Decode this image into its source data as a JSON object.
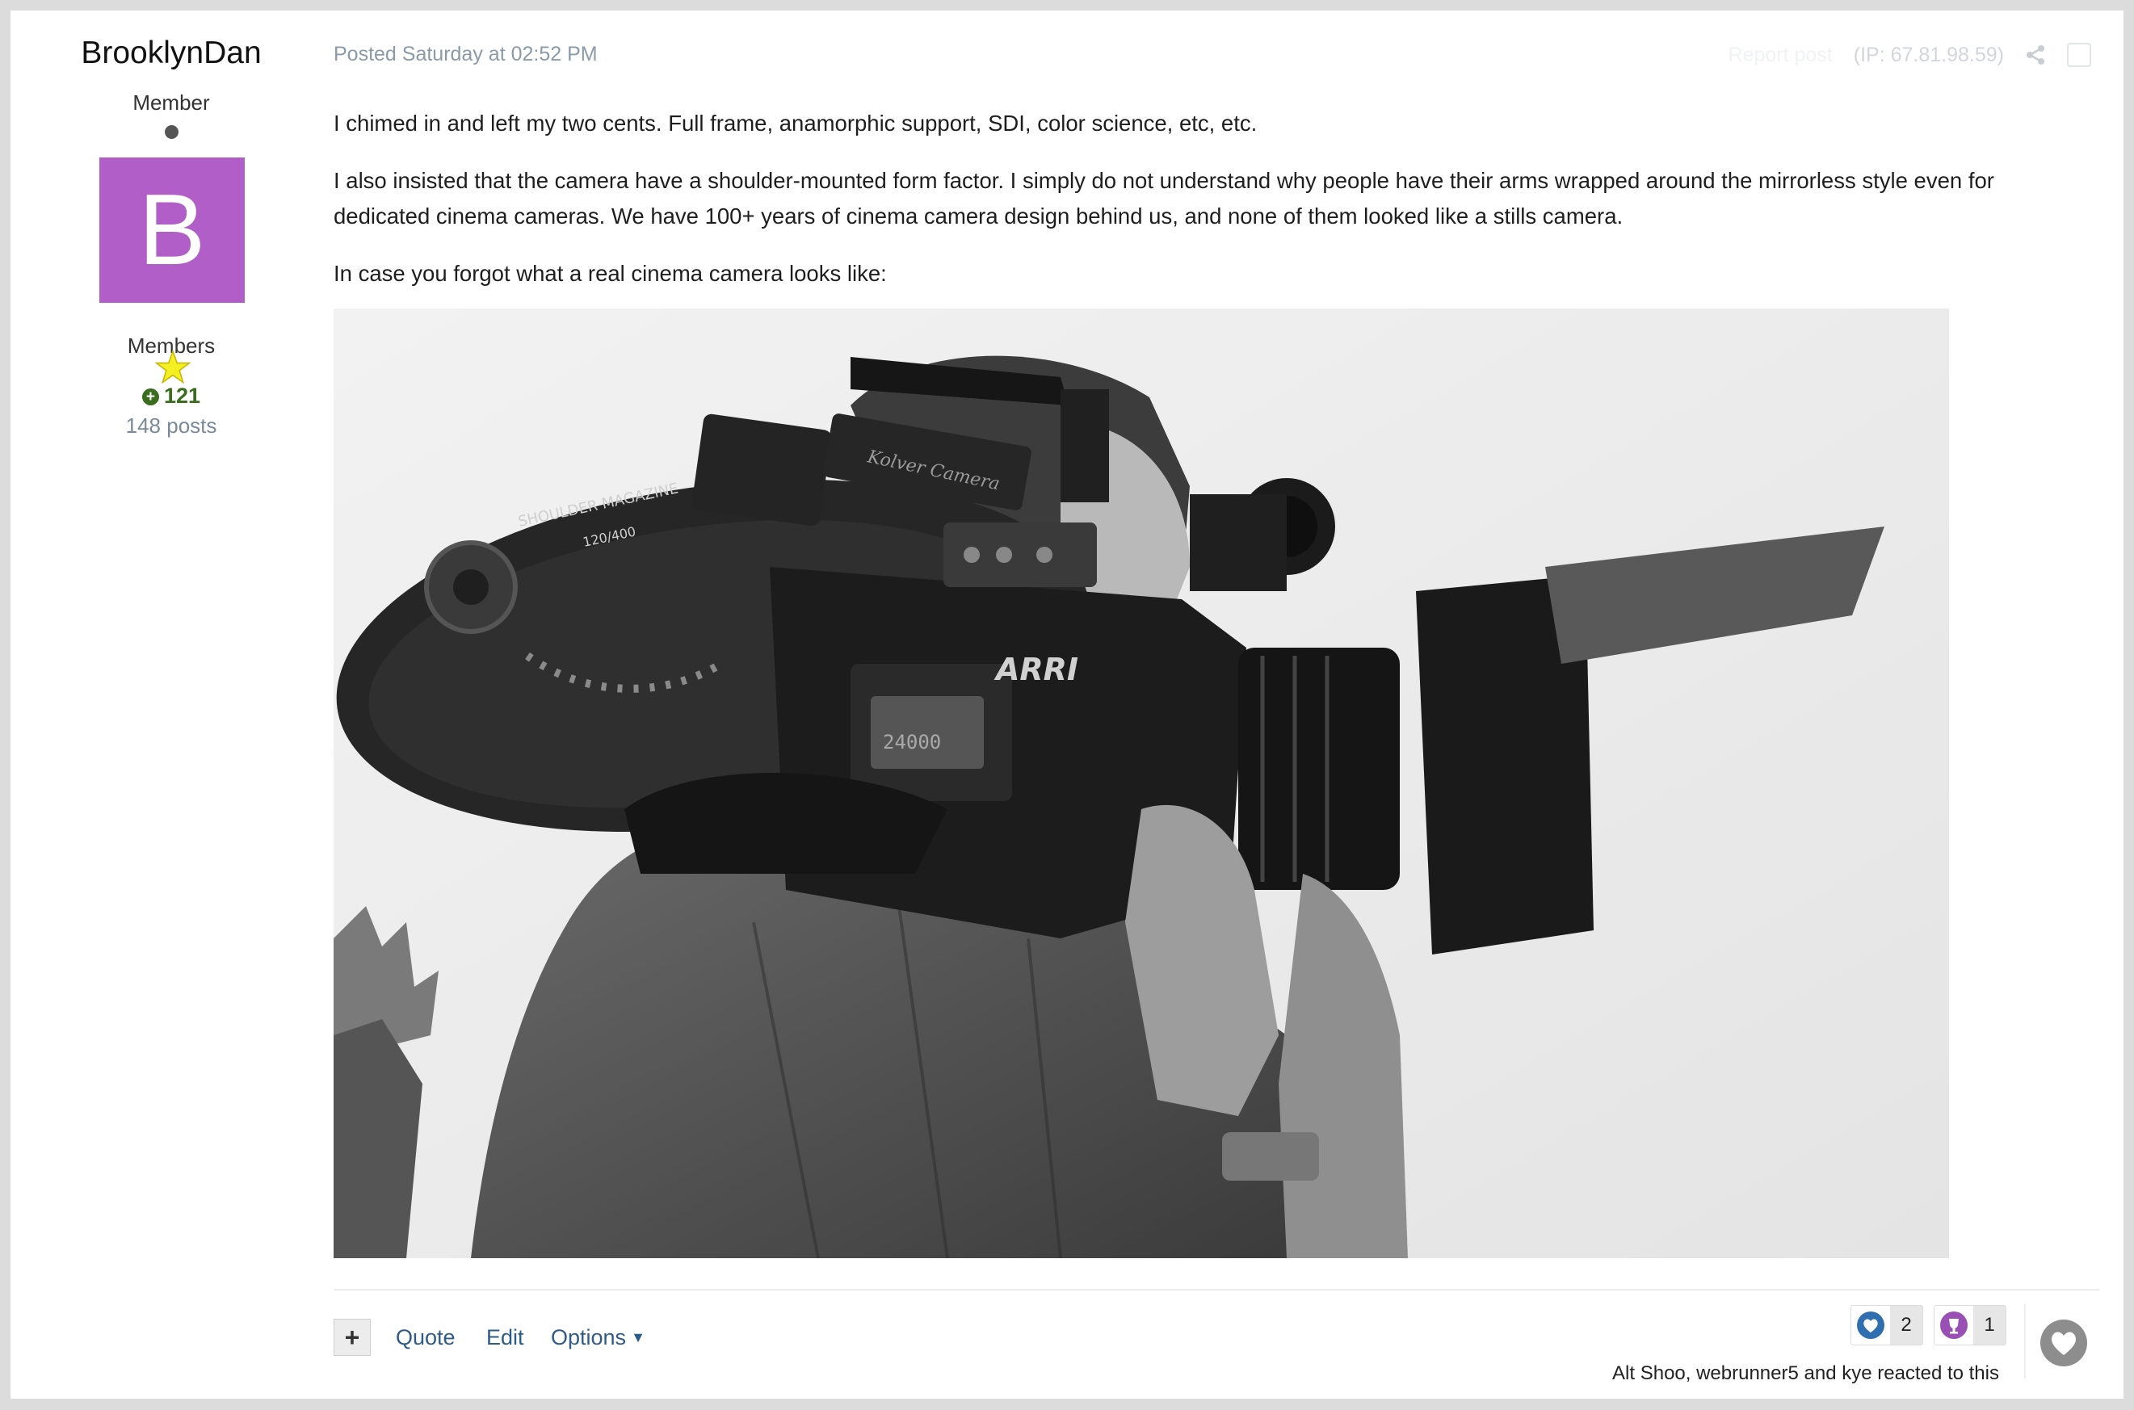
{
  "author": {
    "name": "BrooklynDan",
    "title": "Member",
    "avatar_letter": "B",
    "avatar_color": "#b25ec8",
    "group": "Members",
    "reputation": "121",
    "posts": "148 posts"
  },
  "post": {
    "meta": "Posted Saturday at 02:52 PM",
    "report_label": "Report post",
    "ip_label": "(IP: 67.81.98.59)",
    "paragraphs": [
      "I chimed in and left my two cents. Full frame, anamorphic support, SDI, color science, etc, etc.",
      "I also insisted that the camera have a shoulder-mounted form factor. I simply do not understand why people have their arms wrapped around the mirrorless style even for dedicated cinema cameras. We have 100+ years of cinema camera design behind us, and none of them looked like a stills camera.",
      "In case you forgot what a real cinema camera looks like:"
    ],
    "image_labels": {
      "magazine": "SHOULDER MAGAZINE",
      "magazine_size": "120/400",
      "brand": "ARRI",
      "model_text": "Kolver Camera",
      "display": "24000"
    }
  },
  "actions": {
    "plus": "+",
    "quote": "Quote",
    "edit": "Edit",
    "options": "Options"
  },
  "reactions": {
    "like_count": "2",
    "trophy_count": "1",
    "summary": "Alt Shoo, webrunner5 and kye reacted to this",
    "like_color": "#2f6fb0",
    "trophy_color": "#9a4fb5"
  }
}
